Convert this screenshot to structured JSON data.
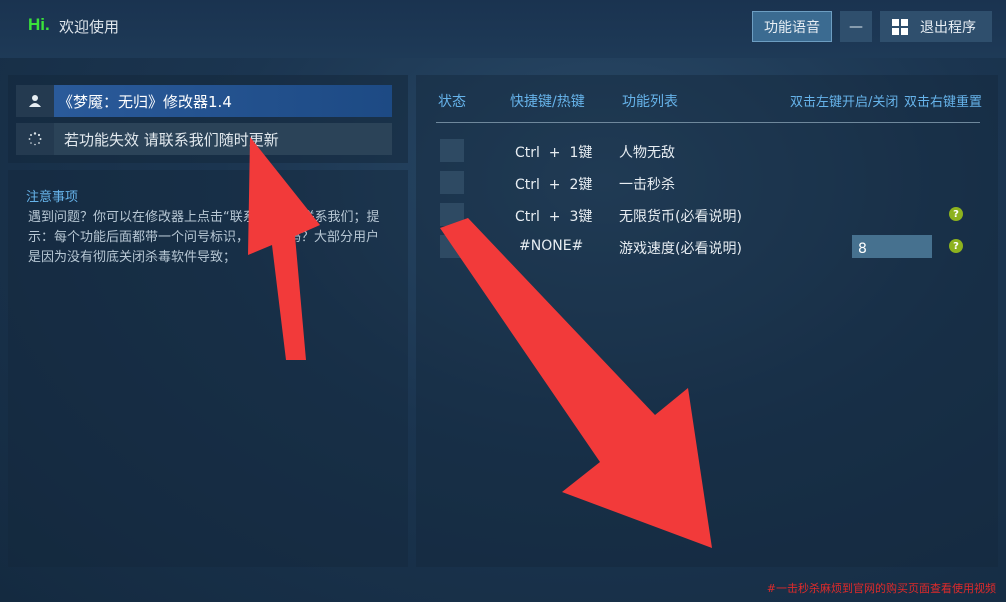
{
  "header": {
    "logo": "Hi.",
    "welcome": "欢迎使用",
    "voice_button": "功能语音",
    "minimize_button": "—",
    "exit_button": "退出程序"
  },
  "sidebar": {
    "title_item": "《梦魇：无归》修改器1.4",
    "info_item": "若功能失效 请联系我们随时更新"
  },
  "notes": {
    "title": "注意事项",
    "body": "遇到问题？你可以在修改器上点击“联系客服”来联系我们；提示：每个功能后面都带一个问号标识，您看了吗？大部分用户是因为没有彻底关闭杀毒软件导致；"
  },
  "table": {
    "col_status": "状态",
    "col_hotkey": "快捷键/热键",
    "col_features": "功能列表",
    "hint_left": "双击左键开启/关闭",
    "hint_right": "双击右键重置",
    "rows": [
      {
        "hotkey": "Ctrl  +  1键",
        "feature": "人物无敌",
        "help": false
      },
      {
        "hotkey": "Ctrl  +  2键",
        "feature": "一击秒杀",
        "help": false
      },
      {
        "hotkey": "Ctrl  +  3键",
        "feature": "无限货币(必看说明)",
        "help": true
      },
      {
        "hotkey": "#NONE#",
        "feature": "游戏速度(必看说明)",
        "help": true
      }
    ],
    "speed_value": "8",
    "help_glyph": "?"
  },
  "footer": {
    "notice": "#一击秒杀麻烦到官网的购买页面查看使用视频"
  },
  "colors": {
    "accent_blue": "#66b3ea",
    "logo_green": "#3ae33a",
    "arrow_red": "#f23a3a",
    "help_green": "#8db21e"
  }
}
